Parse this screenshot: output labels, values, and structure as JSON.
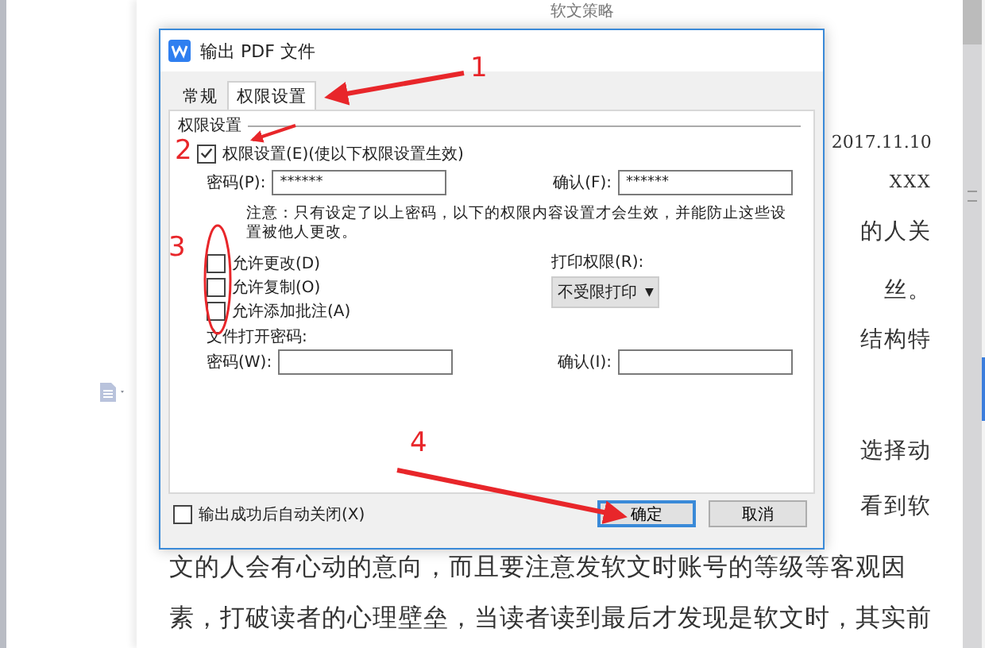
{
  "document": {
    "header": "软文策略",
    "lines": [
      {
        "kind": "right",
        "text": "2017.11.10"
      },
      {
        "kind": "right",
        "text": "XXX"
      },
      {
        "kind": "right",
        "text": "的人关"
      },
      {
        "kind": "right",
        "text": "丝。"
      },
      {
        "kind": "right",
        "text": "结构特"
      },
      {
        "kind": "right",
        "text": "选择动"
      },
      {
        "kind": "right",
        "text": "看到软"
      },
      {
        "kind": "full",
        "text": "文的人会有心动的意向，而且要注意发软文时账号的等级等客观因"
      },
      {
        "kind": "full",
        "text": "素，打破读者的心理壁垒，当读者读到最后才发现是软文时，其实前"
      }
    ]
  },
  "dialog": {
    "title": "输出 PDF 文件",
    "tabs": [
      {
        "label": "常规",
        "selected": false
      },
      {
        "label": "权限设置",
        "selected": true
      }
    ],
    "group_title": "权限设置",
    "enable": {
      "label": "权限设置(E)(使以下权限设置生效)",
      "checked": true
    },
    "password": {
      "label": "密码(P):",
      "value": "******"
    },
    "confirm": {
      "label": "确认(F):",
      "value": "******"
    },
    "note": "注意：只有设定了以上密码，以下的权限内容设置才会生效，并能防止这些设置被他人更改。",
    "permissions": [
      {
        "label": "允许更改(D)",
        "checked": false
      },
      {
        "label": "允许复制(O)",
        "checked": false
      },
      {
        "label": "允许添加批注(A)",
        "checked": false
      }
    ],
    "print": {
      "label": "打印权限(R):",
      "value": "不受限打印",
      "caret": "▼"
    },
    "open_password_title": "文件打开密码:",
    "open_password": {
      "label": "密码(W):"
    },
    "open_confirm": {
      "label": "确认(I):"
    },
    "auto_close": {
      "label": "输出成功后自动关闭(X)",
      "checked": false
    },
    "buttons": [
      {
        "label": "确定",
        "kind": "default"
      },
      {
        "label": "取消",
        "kind": "normal"
      }
    ]
  },
  "annotations": [
    {
      "label": "1"
    },
    {
      "label": "2"
    },
    {
      "label": "3"
    },
    {
      "label": "4"
    }
  ]
}
